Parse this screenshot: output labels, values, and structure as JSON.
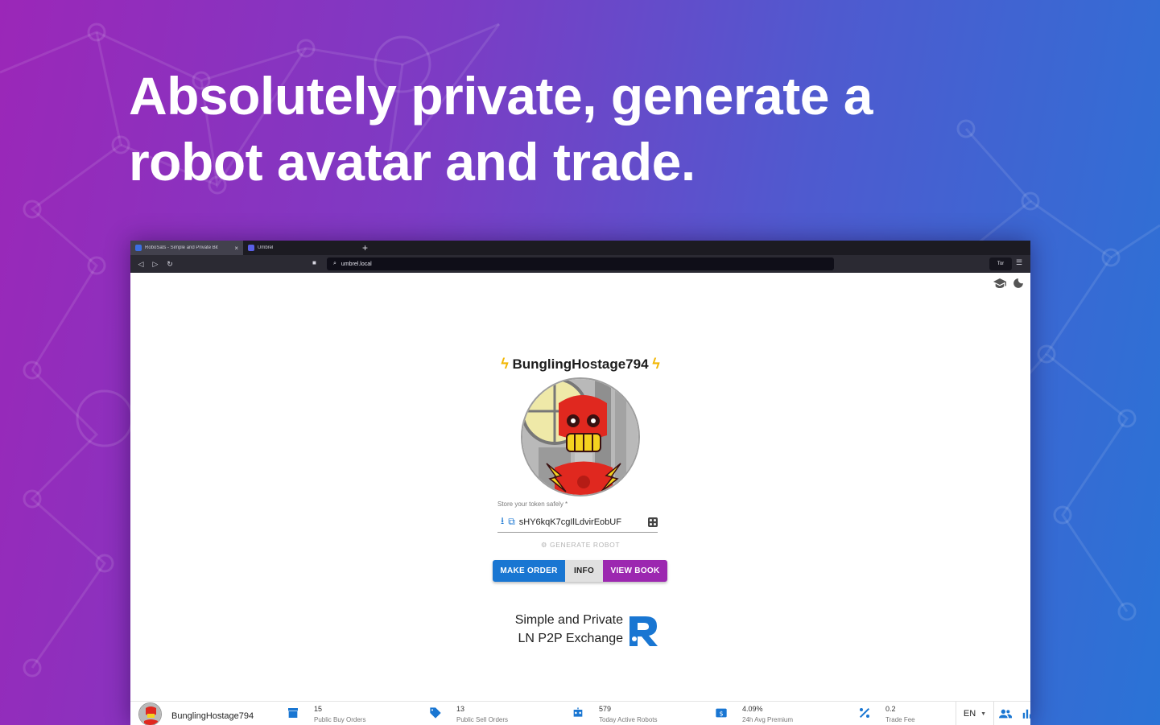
{
  "headline": {
    "line1": "Absolutely private, generate a",
    "line2": "robot avatar and trade."
  },
  "browser": {
    "tabs": [
      {
        "title": "RoboSats - Simple and Private Bit",
        "active": true,
        "close": "×"
      },
      {
        "title": "Umbrel",
        "active": false
      }
    ],
    "new_tab": "+",
    "url": "umbrel.local",
    "tor_label": "Tor",
    "menu_glyph": "☰"
  },
  "app": {
    "nickname": "BunglingHostage794",
    "token": {
      "label": "Store your token safely *",
      "value": "sHY6kqK7cgIlLdvirEobUF"
    },
    "generate_label": "GENERATE ROBOT",
    "buttons": {
      "make_order": "MAKE ORDER",
      "info": "INFO",
      "view_book": "VIEW BOOK"
    },
    "tagline": {
      "line1": "Simple and Private",
      "line2": "LN P2P Exchange"
    }
  },
  "bottombar": {
    "nickname": "BunglingHostage794",
    "stats": [
      {
        "value": "15",
        "label": "Public Buy Orders",
        "icon": "inventory-icon"
      },
      {
        "value": "13",
        "label": "Public Sell Orders",
        "icon": "sell-tag-icon"
      },
      {
        "value": "579",
        "label": "Today Active Robots",
        "icon": "robot-icon"
      },
      {
        "value": "4.09%",
        "label": "24h Avg Premium",
        "icon": "price-change-icon"
      },
      {
        "value": "0.2",
        "label": "Trade Fee",
        "icon": "percent-icon"
      }
    ],
    "language": "EN"
  },
  "colors": {
    "primary": "#1976d2",
    "secondary": "#9c27b0",
    "bolt": "#f2b705",
    "bg_left": "#9b27b8",
    "bg_right": "#2a73d6"
  }
}
